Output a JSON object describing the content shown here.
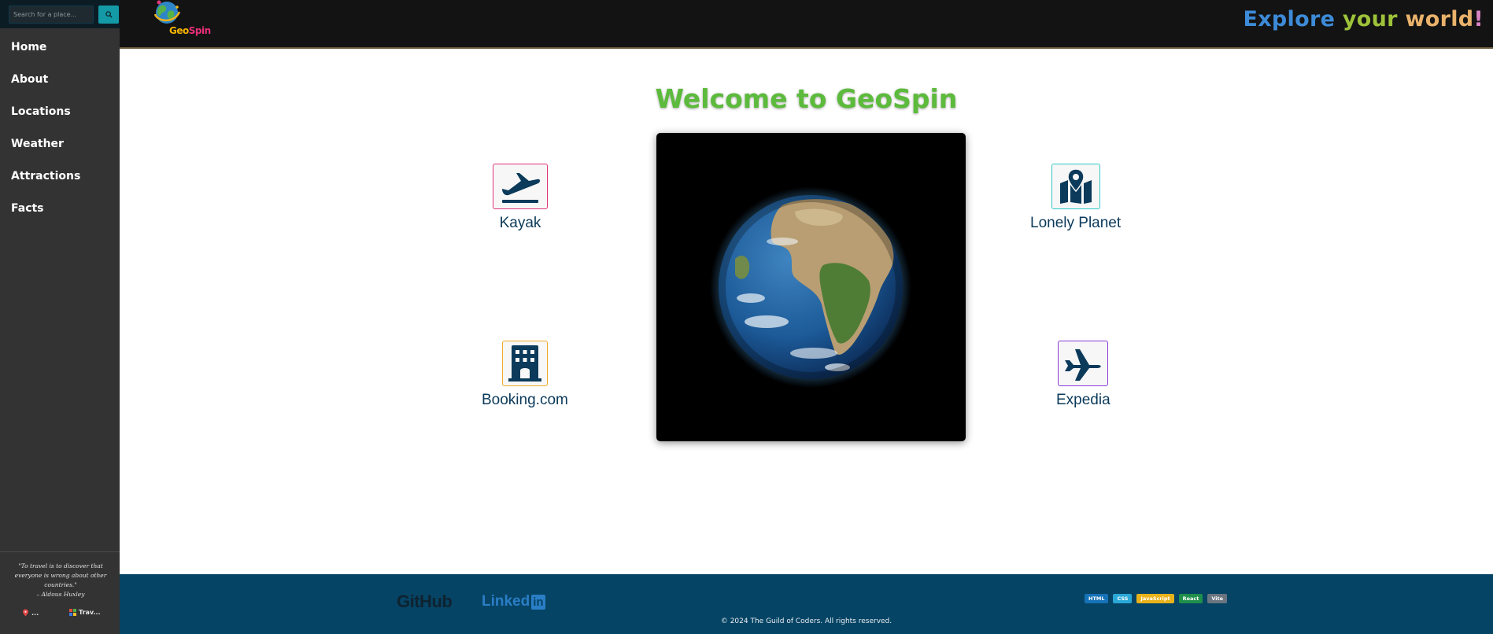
{
  "search": {
    "placeholder": "Search for a place..."
  },
  "sidebar": {
    "items": [
      {
        "label": "Home"
      },
      {
        "label": "About"
      },
      {
        "label": "Locations"
      },
      {
        "label": "Weather"
      },
      {
        "label": "Attractions"
      },
      {
        "label": "Facts"
      }
    ],
    "quote": {
      "text": "\"To travel is to discover that everyone is wrong about other countries.\"",
      "author": "– Aldous Huxley"
    },
    "mini_items": [
      {
        "label": "...",
        "icon": "pin-icon"
      },
      {
        "label": "Trav...",
        "icon": "grid-icon"
      }
    ]
  },
  "header": {
    "logo_text_1": "Geo",
    "logo_text_2": "Spin",
    "tagline_1": "Explore",
    "tagline_2": "your",
    "tagline_3": "world",
    "tagline_4": "!"
  },
  "main": {
    "title": "Welcome to GeoSpin",
    "links": [
      {
        "label": "Kayak",
        "icon": "plane-departure-icon",
        "border": "#e0337a"
      },
      {
        "label": "Lonely Planet",
        "icon": "map-location-icon",
        "border": "#33c9c4"
      },
      {
        "label": "Booking.com",
        "icon": "hotel-icon",
        "border": "#f0a928"
      },
      {
        "label": "Expedia",
        "icon": "plane-icon",
        "border": "#8a3ad6"
      }
    ]
  },
  "footer": {
    "github": "GitHub",
    "linkedin": "Linked",
    "linkedin_in": "in",
    "badges": [
      {
        "label": "HTML",
        "color": "#1572b6"
      },
      {
        "label": "CSS",
        "color": "#29a8d8"
      },
      {
        "label": "JavaScript",
        "color": "#e8b21a"
      },
      {
        "label": "React",
        "color": "#1f8f4c"
      },
      {
        "label": "Vite",
        "color": "#6b7580"
      }
    ],
    "copyright": "© 2024 The Guild of Coders. All rights reserved."
  }
}
